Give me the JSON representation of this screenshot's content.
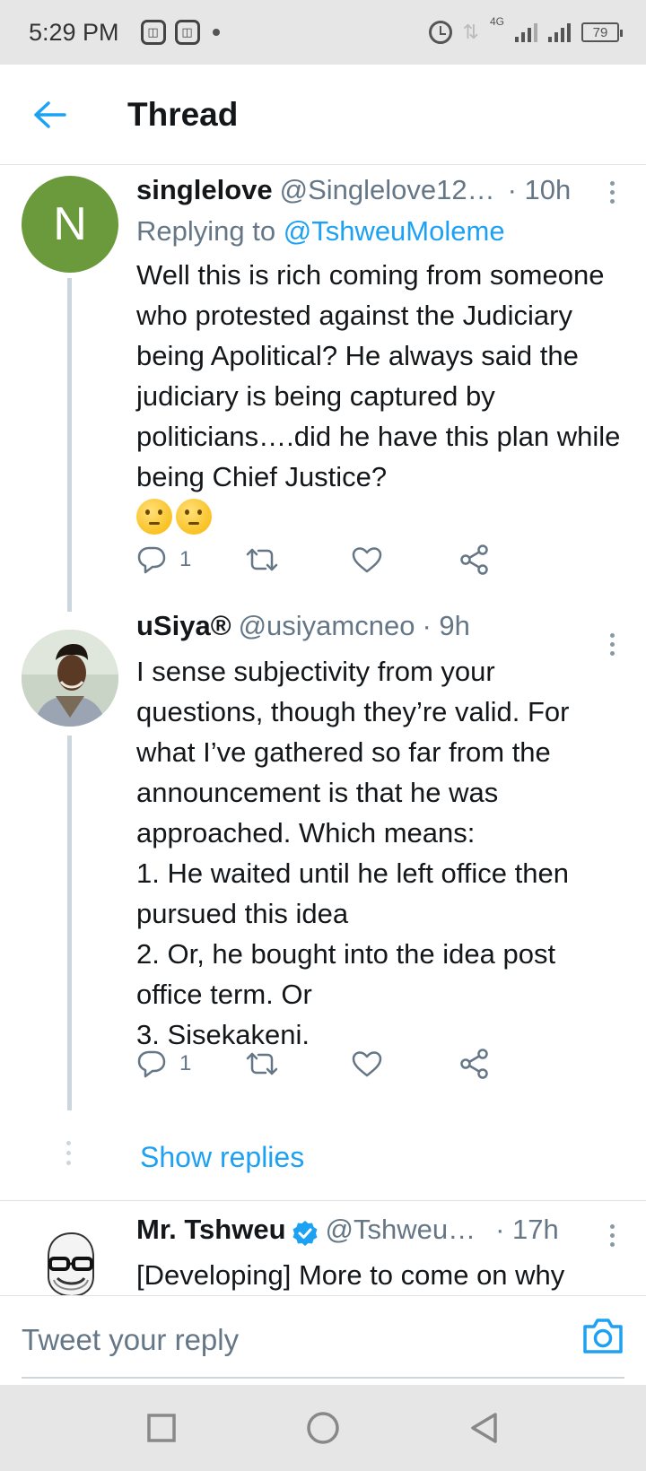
{
  "status_bar": {
    "time": "5:29 PM",
    "network_label": "4G",
    "battery": "79",
    "icons": [
      "app-icon",
      "app-icon",
      "alarm-icon",
      "data-arrows-icon",
      "signal-icon",
      "battery-icon"
    ]
  },
  "header": {
    "title": "Thread",
    "back_icon": "arrow-left-icon",
    "accent": "#1da1f2"
  },
  "tweets": [
    {
      "avatar_letter": "N",
      "avatar_color": "#6a9a3b",
      "name": "singlelove",
      "handle": "@Singlelove12…",
      "time": "· 10h",
      "replying_label": "Replying to",
      "replying_handle": "@TshweuMoleme",
      "text": "Well this is rich coming from someone who protested against the Judiciary being Apolitical? He always said the judiciary is being captured by politicians….did he have this plan while being Chief Justice?",
      "emoji": [
        "🤔",
        "🤔"
      ],
      "reply_count": "1"
    },
    {
      "name": "uSiya®",
      "handle": "@usiyamcneo",
      "time": "· 9h",
      "text": "I sense subjectivity from your questions, though they’re valid. For what I’ve gathered so far from the announcement is that he was approached. Which means:\n1. He waited until he left office then pursued this idea\n2. Or, he bought into the idea post office term. Or\n3. Sisekakeni.",
      "reply_count": "1"
    },
    {
      "name": "Mr. Tshweu",
      "verified": true,
      "handle": "@Tshweu…",
      "time": "· 17h",
      "text": "[Developing] More to come on why"
    }
  ],
  "show_replies": "Show replies",
  "reply_bar": {
    "placeholder": "Tweet your reply",
    "camera_icon": "camera-icon"
  },
  "nav_bar": {
    "icons": [
      "square-icon",
      "circle-icon",
      "triangle-back-icon"
    ]
  }
}
